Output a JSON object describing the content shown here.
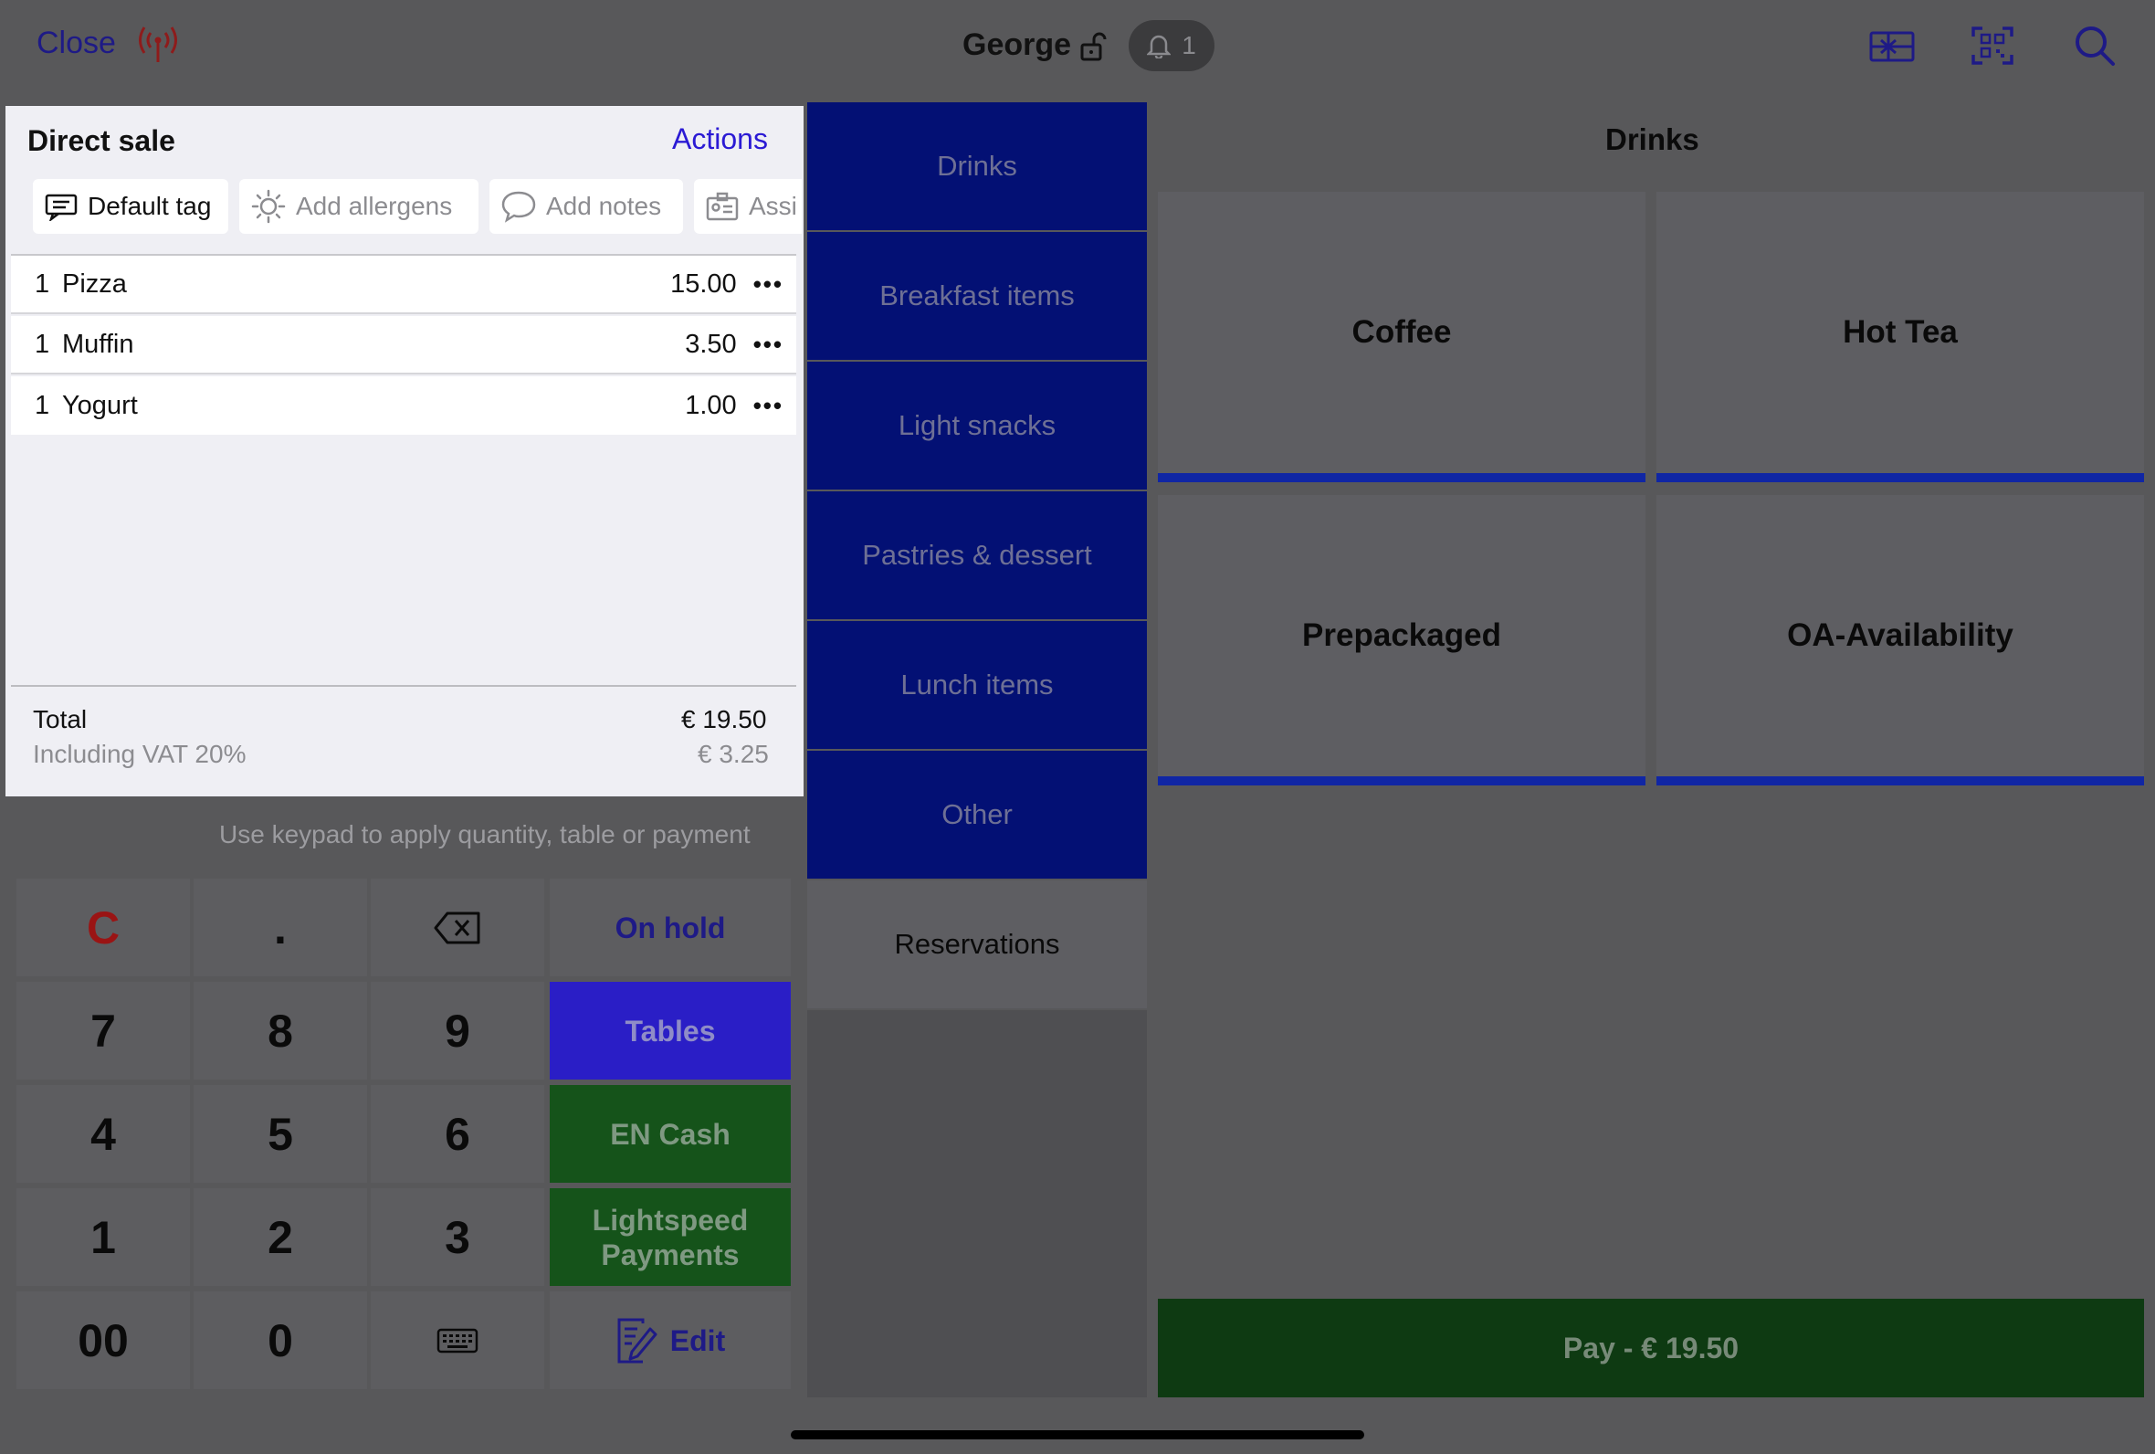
{
  "header": {
    "close_label": "Close",
    "user_name": "George",
    "notification_count": "1",
    "icons": [
      "signal-icon",
      "lock-icon",
      "bell-icon",
      "gift-card-icon",
      "qr-scan-icon",
      "search-icon"
    ]
  },
  "order": {
    "title": "Direct sale",
    "actions_label": "Actions",
    "chips": {
      "default_tag": "Default tag",
      "add_allergens": "Add allergens",
      "add_notes": "Add notes",
      "assign": "Assi"
    },
    "items": [
      {
        "qty": "1",
        "name": "Pizza",
        "price": "15.00"
      },
      {
        "qty": "1",
        "name": "Muffin",
        "price": "3.50"
      },
      {
        "qty": "1",
        "name": "Yogurt",
        "price": "1.00"
      }
    ],
    "more_label": "•••",
    "total_label": "Total",
    "total_value": "€ 19.50",
    "vat_label": "Including VAT 20%",
    "vat_value": "€ 3.25"
  },
  "keypad": {
    "hint": "Use keypad to apply quantity, table or payment",
    "keys": [
      "C",
      ".",
      "7",
      "8",
      "9",
      "4",
      "5",
      "6",
      "1",
      "2",
      "3",
      "00",
      "0"
    ],
    "on_hold": "On hold",
    "tables": "Tables",
    "en_cash": "EN Cash",
    "lightspeed": "Lightspeed Payments",
    "edit": "Edit"
  },
  "categories": [
    "Drinks",
    "Breakfast items",
    "Light snacks",
    "Pastries & dessert",
    "Lunch items",
    "Other",
    "Reservations"
  ],
  "products": {
    "title": "Drinks",
    "items": [
      "Coffee",
      "Hot Tea",
      "Prepackaged",
      "OA-Availability"
    ]
  },
  "pay_label": "Pay - € 19.50",
  "colors": {
    "brand_blue": "#031074",
    "accent_indigo": "#2b1ad4",
    "cash_green": "#15531a",
    "pay_green": "#0e3a12",
    "clear_red": "#9a1414",
    "product_accent": "#1026a4"
  }
}
